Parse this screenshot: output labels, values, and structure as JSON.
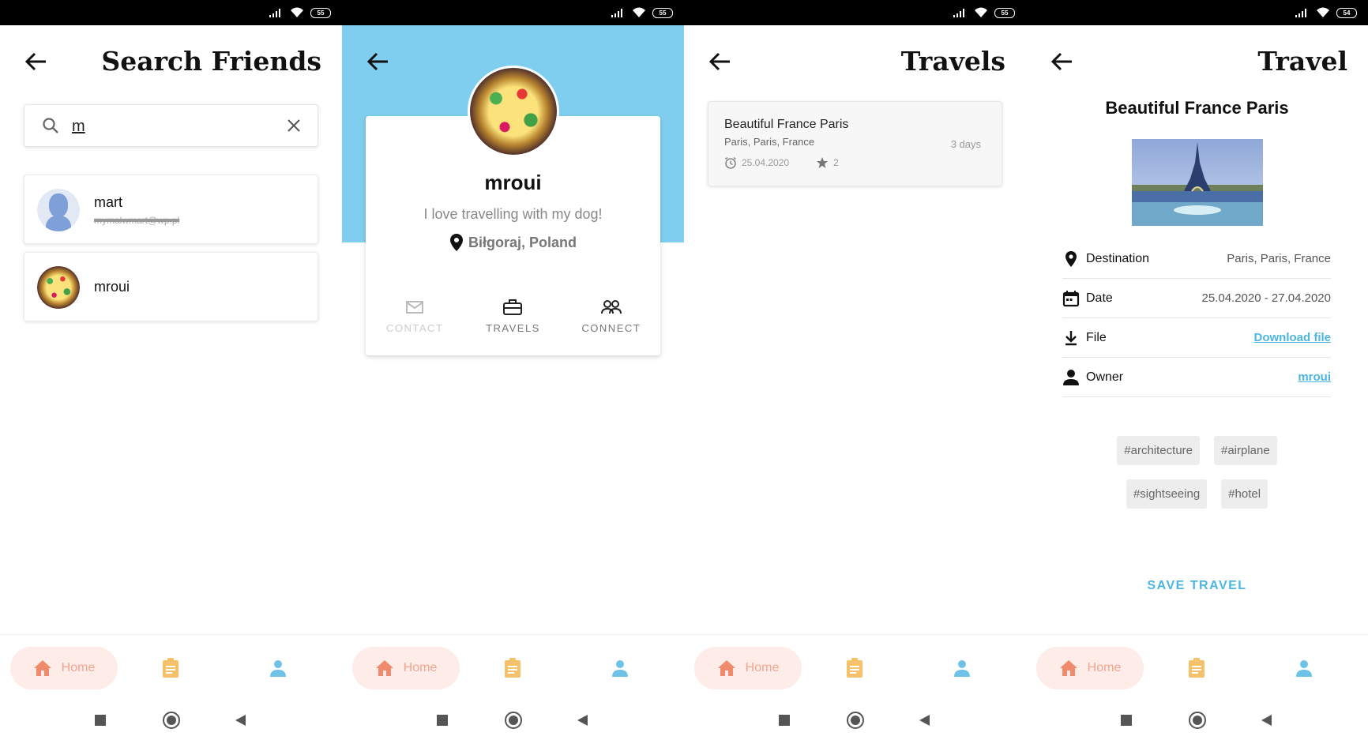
{
  "status_bar": [
    {
      "battery": "55"
    },
    {
      "battery": "55"
    },
    {
      "battery": "55"
    },
    {
      "battery": "54"
    }
  ],
  "colors": {
    "header_blue": "#80ceef",
    "accent_blue": "#4bb6e0",
    "home_pill_bg": "#fdece7",
    "home_pill_text": "#f3a590",
    "travels_icon": "#f5c26b"
  },
  "search_friends": {
    "title": "Search Friends",
    "search_value": "m",
    "results": [
      {
        "name": "mart",
        "email": "mymalwmart@wp.pl",
        "avatar": "default-person-avatar"
      },
      {
        "name": "mroui",
        "avatar": "profile-photo"
      }
    ]
  },
  "profile": {
    "name": "mroui",
    "bio": "I love travelling with my dog!",
    "location": "Biłgoraj, Poland",
    "actions": {
      "contact": "CONTACT",
      "travels": "TRAVELS",
      "connect": "CONNECT"
    }
  },
  "travels": {
    "title": "Travels",
    "items": [
      {
        "title": "Beautiful France Paris",
        "place": "Paris, Paris, France",
        "duration": "3 days",
        "date": "25.04.2020",
        "stars": "2"
      }
    ]
  },
  "travel_detail": {
    "title": "Travel",
    "name": "Beautiful France Paris",
    "rows": {
      "destination_label": "Destination",
      "destination_value": "Paris, Paris, France",
      "date_label": "Date",
      "date_value": "25.04.2020 - 27.04.2020",
      "file_label": "File",
      "file_value": "Download file",
      "owner_label": "Owner",
      "owner_value": "mroui"
    },
    "tags": [
      "#architecture",
      "#airplane",
      "#sightseeing",
      "#hotel"
    ],
    "save_label": "SAVE TRAVEL"
  },
  "bottom_nav": {
    "home_label": "Home"
  }
}
